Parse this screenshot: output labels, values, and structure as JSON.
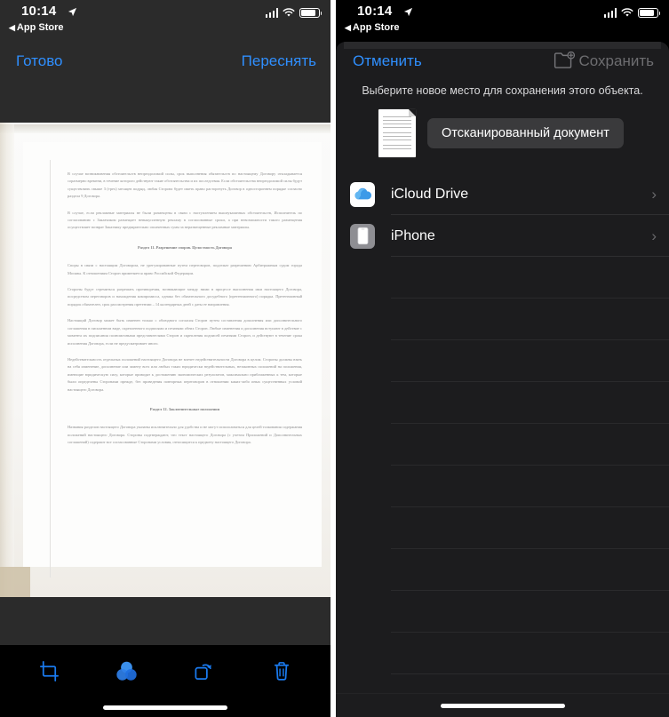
{
  "status_bar": {
    "time": "10:14",
    "back_label": "App Store",
    "back_triangle": "◀",
    "location_icon": "location-arrow-icon",
    "signal_icon": "cellular-signal-icon",
    "wifi_icon": "wifi-icon",
    "battery_icon": "battery-icon"
  },
  "left_screen": {
    "navbar": {
      "done_label": "Готово",
      "retake_label": "Переснять"
    },
    "document": {
      "paragraphs": [
        "В случае возникновения обстоятельств непреодолимой силы, срок выполнения обязательств по настоящему Договору откладывается соразмерно времени, в течение которого действуют такие обстоятельства и их последствия. Если обстоятельства непреодолимой силы будут существовать свыше 3 (трех) месяцев подряд, любая Сторона будет иметь право расторгнуть Договор в одностороннем порядке согласно раздела 9 Договора.",
        "В случае, если рекламные материалы не были размещены в связи с наступлением вышеуказанных обстоятельств, Исполнитель по согласованию с Заказчиком размещает невыкупленную рекламу в согласованные сроки, а при невозможности такого размещения осуществляет возврат Заказчику предварительно оплаченных сумм за неразмещенные рекламные материалы."
      ],
      "heading_11": "Раздел 11. Разрешение споров. Целостность Договора",
      "paragraphs_11": [
        "Споры в связи с настоящим Договором, не урегулированные путем переговоров, подлежат разрешению Арбитражным судом города Москвы. К отношениям Сторон применяется право Российской Федерации.",
        "Стороны будут стремиться разрешать противоречия, возникающие между ними в процессе выполнения ими настоящего Договора, посредством переговоров и нахождения компромисса, однако без обязательного досудебного (претензионного) порядка. Претензионный порядок обязателен, срок рассмотрения претензии – 14 календарных дней с даты ее направления.",
        "Настоящий Договор может быть изменен только с обоюдного согласия Сторон путем составления дополнения или дополнительного соглашения в письменном виде, скрепленного подписями и печатями обеих Сторон. Любые изменения и дополнения вступают в действие с момента их подписания полномочными представителями Сторон и скрепления подписей печатями Сторон, и действуют в течение срока исполнения Договора, если не предусматривает иного.",
        "Недействительность отдельных положений настоящего Договора не влечет недействительности Договора в целом. Стороны должны взять на себя изменение, дополнение или замену всех или любых таких юридически недействительных, незаконных положений на положения, имеющие юридическую силу, которые приводят к достижению экономических результатов, максимально приближенных к тем, которые были определены Сторонами прежде, без проведения повторных переговоров в отношении каких-либо иных существенных условий настоящего Договора."
      ],
      "heading_12": "Раздел 12. Заключительные положения",
      "paragraphs_12": [
        "Названия разделов настоящего Договора указаны исключительно для удобства и не могут использоваться для целей толкования содержания положений настоящего Договора. Стороны подтверждают, что текст настоящего Договора (с учетом Приложений и Дополнительных соглашений) содержит все согласованные Сторонами условия, относящиеся к предмету настоящего Договора."
      ]
    },
    "toolbar": {
      "crop_icon": "crop-icon",
      "filter_icon": "color-filter-icon",
      "rotate_icon": "rotate-icon",
      "delete_icon": "trash-icon"
    }
  },
  "right_screen": {
    "navbar": {
      "cancel_label": "Отменить",
      "save_label": "Сохранить",
      "new_folder_icon": "new-folder-icon"
    },
    "subtitle": "Выберите новое место для сохранения этого объекта.",
    "file_name": "Отсканированный документ",
    "thumbnail_icon": "document-thumbnail-icon",
    "locations": [
      {
        "label": "iCloud Drive",
        "icon": "icloud-icon",
        "chevron": "›"
      },
      {
        "label": "iPhone",
        "icon": "iphone-icon",
        "chevron": "›"
      }
    ]
  },
  "colors": {
    "accent_blue": "#2f8fff",
    "disabled_gray": "#6d6d70",
    "sheet_bg": "#1c1c1e",
    "navbar_bg": "#2b2b2b"
  }
}
